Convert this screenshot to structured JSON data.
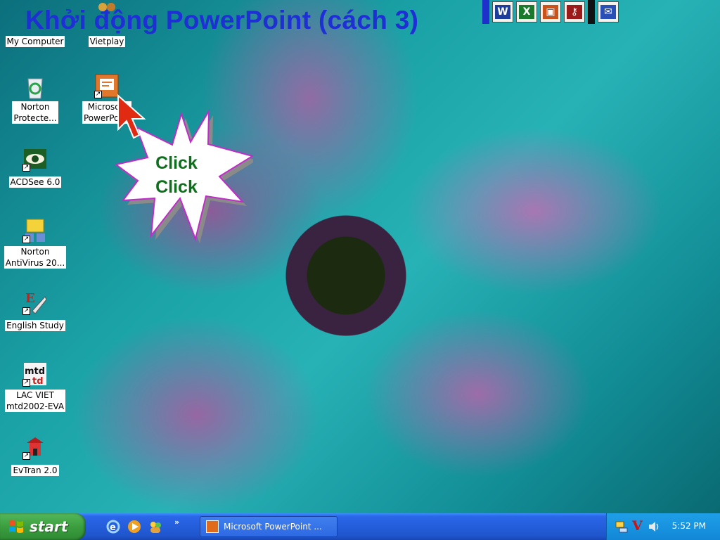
{
  "title": "Khởi động PowerPoint  (cách 3)",
  "desktop_icons": [
    {
      "label": "My Computer",
      "icon": "my-computer-icon"
    },
    {
      "label": "Vietplay",
      "icon": "vietplay-icon"
    },
    {
      "label": "Norton\nProtecte...",
      "icon": "recycle-bin-icon"
    },
    {
      "label": "Microsoft\nPowerPoint",
      "icon": "powerpoint-icon"
    },
    {
      "label": "ACDSee 6.0",
      "icon": "acdsee-icon"
    },
    {
      "label": "Norton\nAntiVirus 20...",
      "icon": "norton-antivirus-icon"
    },
    {
      "label": "English Study",
      "icon": "english-study-icon"
    },
    {
      "label": "LAC VIET\nmtd2002-EVA",
      "icon": "lac-viet-icon"
    },
    {
      "label": "EvTran 2.0",
      "icon": "evtran-icon"
    }
  ],
  "callout": {
    "line1": "Click",
    "line2": "Click"
  },
  "office_bar": [
    "word-icon",
    "excel-icon",
    "powerpoint-icon",
    "access-icon",
    "outlook-icon"
  ],
  "taskbar": {
    "start_label": "start",
    "quick_launch": [
      "internet-explorer-icon",
      "media-player-icon",
      "messenger-icon"
    ],
    "more_label": "»",
    "task_label": "Microsoft PowerPoint ...",
    "tray_icons": [
      "network-icon",
      "vietkey-icon",
      "volume-icon"
    ],
    "tray_vietkey": "V",
    "clock": "5:52 PM"
  },
  "colors": {
    "title": "#1f2fd6",
    "callout_text": "#0d6e1b",
    "taskbar": "#245edb",
    "start": "#3c9e3f"
  }
}
